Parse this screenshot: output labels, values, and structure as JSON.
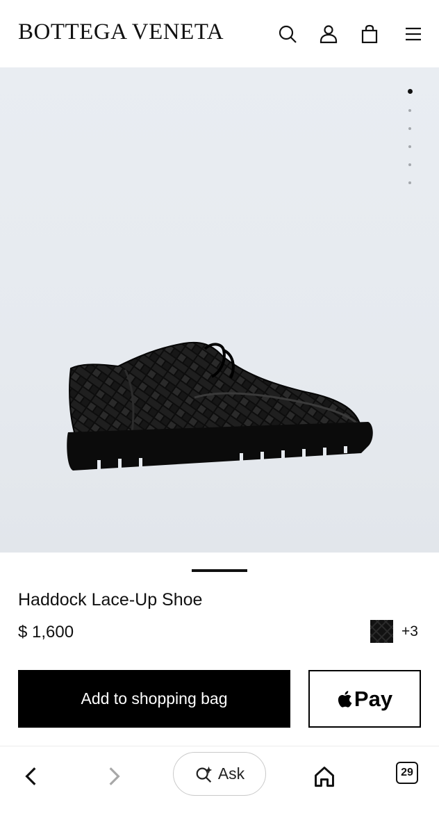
{
  "header": {
    "brand": "BOTTEGA VENETA",
    "icons": [
      "search-icon",
      "account-icon",
      "shopping-bag-icon",
      "menu-icon"
    ]
  },
  "gallery": {
    "image_count": 6,
    "active_index": 0,
    "image_description_icon": "shoe-image"
  },
  "product": {
    "name": "Haddock Lace-Up Shoe",
    "price": "$ 1,600",
    "more_colors": "+3"
  },
  "actions": {
    "add_to_bag": "Add to shopping bag",
    "apple_pay": "Pay"
  },
  "browser_bar": {
    "ask_label": "Ask",
    "tab_count": "29"
  },
  "colors": {
    "primary": "#000000",
    "background": "#ffffff",
    "gallery_bg": "#e7ebf0"
  }
}
